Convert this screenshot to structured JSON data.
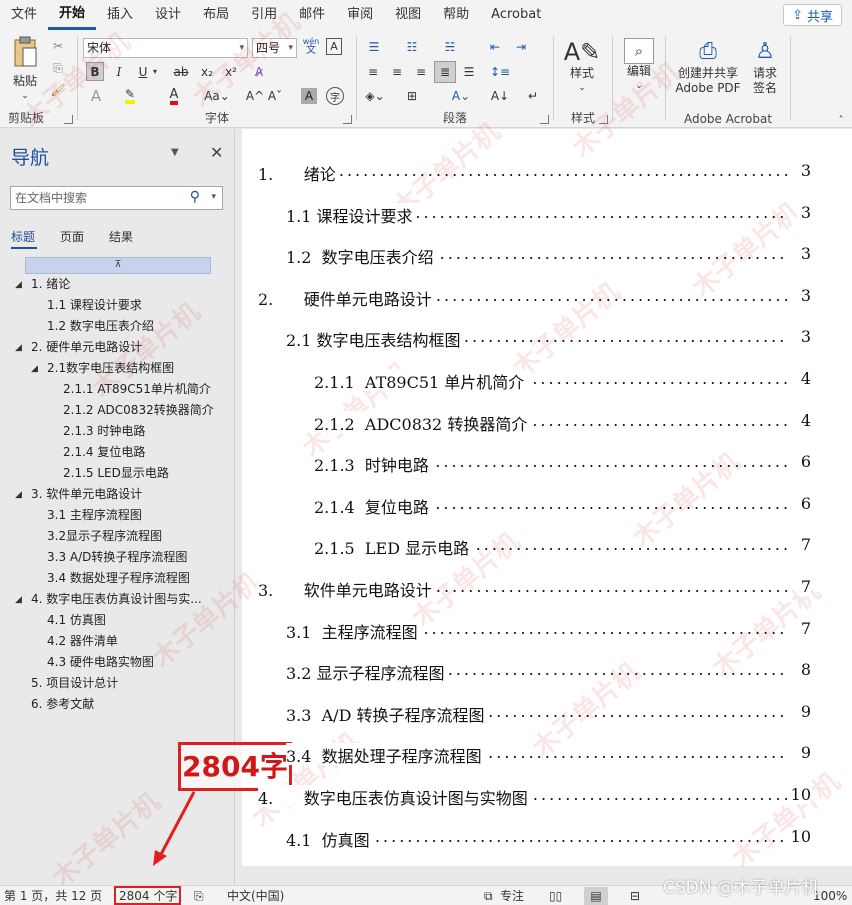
{
  "menu": {
    "items": [
      "文件",
      "开始",
      "插入",
      "设计",
      "布局",
      "引用",
      "邮件",
      "审阅",
      "视图",
      "帮助",
      "Acrobat"
    ],
    "active_index": 1,
    "share_label": "共享"
  },
  "ribbon": {
    "clipboard": {
      "paste_label": "粘贴",
      "group_label": "剪贴板"
    },
    "font": {
      "font_name": "宋体",
      "font_size": "四号",
      "wen_label": "wén",
      "group_label": "字体"
    },
    "paragraph": {
      "group_label": "段落"
    },
    "styles": {
      "label": "样式",
      "group_label": "样式"
    },
    "editing": {
      "label": "编辑"
    },
    "acrobat": {
      "create_share_label_1": "创建并共享",
      "create_share_label_2": "Adobe PDF",
      "request_sign_label_1": "请求",
      "request_sign_label_2": "签名",
      "group_label": "Adobe Acrobat"
    }
  },
  "nav": {
    "title": "导航",
    "search_placeholder": "在文档中搜索",
    "tabs": [
      "标题",
      "页面",
      "结果"
    ],
    "tree": [
      {
        "label": "1. 绪论",
        "level": 0,
        "arrow": true
      },
      {
        "label": "1.1 课程设计要求",
        "level": 1,
        "arrow": false
      },
      {
        "label": "1.2 数字电压表介绍",
        "level": 1,
        "arrow": false
      },
      {
        "label": "2. 硬件单元电路设计",
        "level": 0,
        "arrow": true
      },
      {
        "label": "2.1数字电压表结构框图",
        "level": 1,
        "arrow": true
      },
      {
        "label": "2.1.1 AT89C51单片机简介",
        "level": 2,
        "arrow": false
      },
      {
        "label": "2.1.2 ADC0832转换器简介",
        "level": 2,
        "arrow": false
      },
      {
        "label": "2.1.3 时钟电路",
        "level": 2,
        "arrow": false
      },
      {
        "label": "2.1.4 复位电路",
        "level": 2,
        "arrow": false
      },
      {
        "label": "2.1.5 LED显示电路",
        "level": 2,
        "arrow": false
      },
      {
        "label": "3. 软件单元电路设计",
        "level": 0,
        "arrow": true
      },
      {
        "label": "3.1 主程序流程图",
        "level": 1,
        "arrow": false
      },
      {
        "label": "3.2显示子程序流程图",
        "level": 1,
        "arrow": false
      },
      {
        "label": "3.3 A/D转换子程序流程图",
        "level": 1,
        "arrow": false
      },
      {
        "label": "3.4 数据处理子程序流程图",
        "level": 1,
        "arrow": false
      },
      {
        "label": "4. 数字电压表仿真设计图与实...",
        "level": 0,
        "arrow": true
      },
      {
        "label": "4.1 仿真图",
        "level": 1,
        "arrow": false
      },
      {
        "label": "4.2 器件清单",
        "level": 1,
        "arrow": false
      },
      {
        "label": "4.3 硬件电路实物图",
        "level": 1,
        "arrow": false
      },
      {
        "label": "5. 项目设计总计",
        "level": 0,
        "arrow": false
      },
      {
        "label": "6. 参考文献",
        "level": 0,
        "arrow": false
      }
    ]
  },
  "toc": [
    {
      "label": "1.      绪论",
      "page": "3",
      "indent": 0
    },
    {
      "label": "1.1 课程设计要求",
      "page": "3",
      "indent": 1
    },
    {
      "label": "1.2  数字电压表介绍",
      "page": "3",
      "indent": 1
    },
    {
      "label": "2.      硬件单元电路设计",
      "page": "3",
      "indent": 0
    },
    {
      "label": "2.1 数字电压表结构框图",
      "page": "3",
      "indent": 1
    },
    {
      "label": "2.1.1  AT89C51 单片机简介",
      "page": "4",
      "indent": 2
    },
    {
      "label": "2.1.2  ADC0832 转换器简介",
      "page": "4",
      "indent": 2
    },
    {
      "label": "2.1.3  时钟电路",
      "page": "6",
      "indent": 2
    },
    {
      "label": "2.1.4  复位电路",
      "page": "6",
      "indent": 2
    },
    {
      "label": "2.1.5  LED 显示电路",
      "page": "7",
      "indent": 2
    },
    {
      "label": "3.      软件单元电路设计",
      "page": "7",
      "indent": 0
    },
    {
      "label": "3.1  主程序流程图",
      "page": "7",
      "indent": 1
    },
    {
      "label": "3.2 显示子程序流程图",
      "page": "8",
      "indent": 1
    },
    {
      "label": "3.3  A/D 转换子程序流程图",
      "page": "9",
      "indent": 1
    },
    {
      "label": "3.4  数据处理子程序流程图",
      "page": "9",
      "indent": 1
    },
    {
      "label": "4.      数字电压表仿真设计图与实物图",
      "page": "10",
      "indent": 0
    },
    {
      "label": "4.1  仿真图",
      "page": "10",
      "indent": 1
    }
  ],
  "status": {
    "page_info": "第 1 页，共 12 页",
    "word_count": "2804 个字",
    "language": "中文(中国)",
    "focus_label": "专注",
    "zoom": "100%"
  },
  "annotation": {
    "text": "2804字"
  },
  "watermark_text": "木子单片机",
  "csdn_mark": "CSDN @木子单片机",
  "colors": {
    "accent": "#1f4e9a",
    "annotation_red": "#e02020"
  }
}
